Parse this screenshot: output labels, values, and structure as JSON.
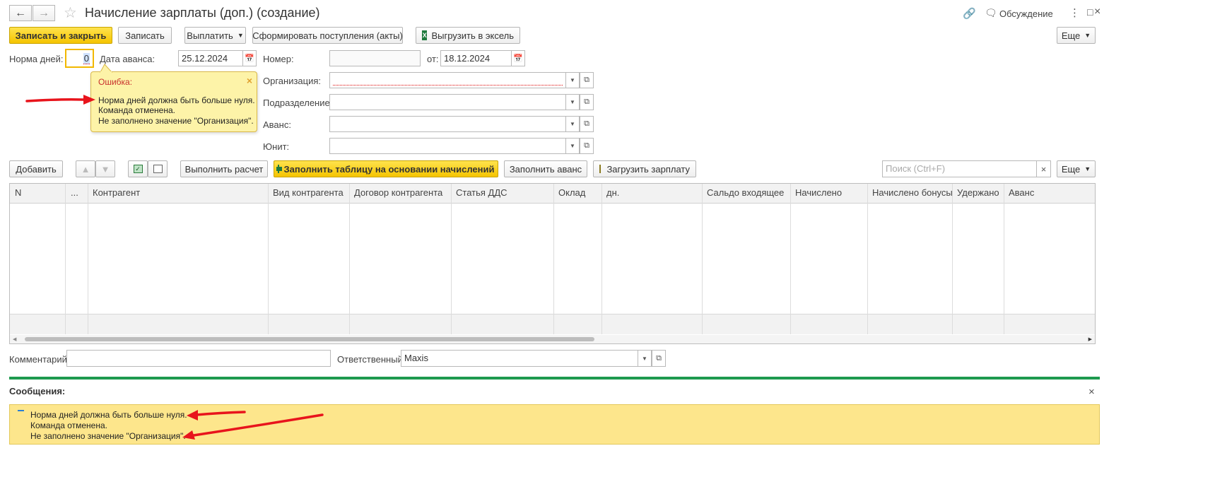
{
  "window": {
    "title": "Начисление зарплаты (доп.) (создание)",
    "discussion_label": "Обсуждение"
  },
  "toolbar": {
    "save_close": "Записать и закрыть",
    "save": "Записать",
    "pay": "Выплатить",
    "form_receipts": "Сформировать поступления (акты)",
    "export_excel": "Выгрузить в эксель",
    "more": "Еще"
  },
  "form": {
    "norm_days_label": "Норма дней:",
    "norm_days_value": "0",
    "advance_date_label": "Дата аванса:",
    "advance_date_value": "25.12.2024",
    "number_label": "Номер:",
    "number_value": "",
    "from_label": "от:",
    "from_value": "18.12.2024",
    "organization_label": "Организация:",
    "organization_value": "",
    "department_label": "Подразделение:",
    "department_value": "",
    "advance_label": "Аванс:",
    "advance_value": "",
    "unit_label": "Юнит:",
    "unit_value": ""
  },
  "error_popup": {
    "title": "Ошибка:",
    "line1": "Норма дней должна быть больше нуля.",
    "line2": "Команда отменена.",
    "line3": "Не заполнено значение \"Организация\"."
  },
  "table_toolbar": {
    "add": "Добавить",
    "calculate": "Выполнить расчет",
    "fill_table": "Заполнить таблицу на основании начислений",
    "fill_advance": "Заполнить аванс",
    "load_salary": "Загрузить зарплату",
    "search_placeholder": "Поиск (Ctrl+F)",
    "more": "Еще"
  },
  "table": {
    "columns": [
      "N",
      "...",
      "Контрагент",
      "Вид контрагента",
      "Договор контрагента",
      "Статья ДДС",
      "Оклад",
      "дн.",
      "Сальдо входящее",
      "Начислено",
      "Начислено бонусы",
      "Удержано",
      "Аванс"
    ]
  },
  "footer": {
    "comment_label": "Комментарий:",
    "comment_value": "",
    "responsible_label": "Ответственный:",
    "responsible_value": "Maxis"
  },
  "messages": {
    "title": "Сообщения:",
    "line1": "Норма дней должна быть больше нуля.",
    "line2": "Команда отменена.",
    "line3": "Не заполнено значение \"Организация\"."
  },
  "colors": {
    "accent_yellow": "#f5c400",
    "popup_bg": "#fdf3a8",
    "messages_bg": "#fde68c",
    "separator_green": "#1e9a4e",
    "arrow_red": "#e8141c"
  }
}
